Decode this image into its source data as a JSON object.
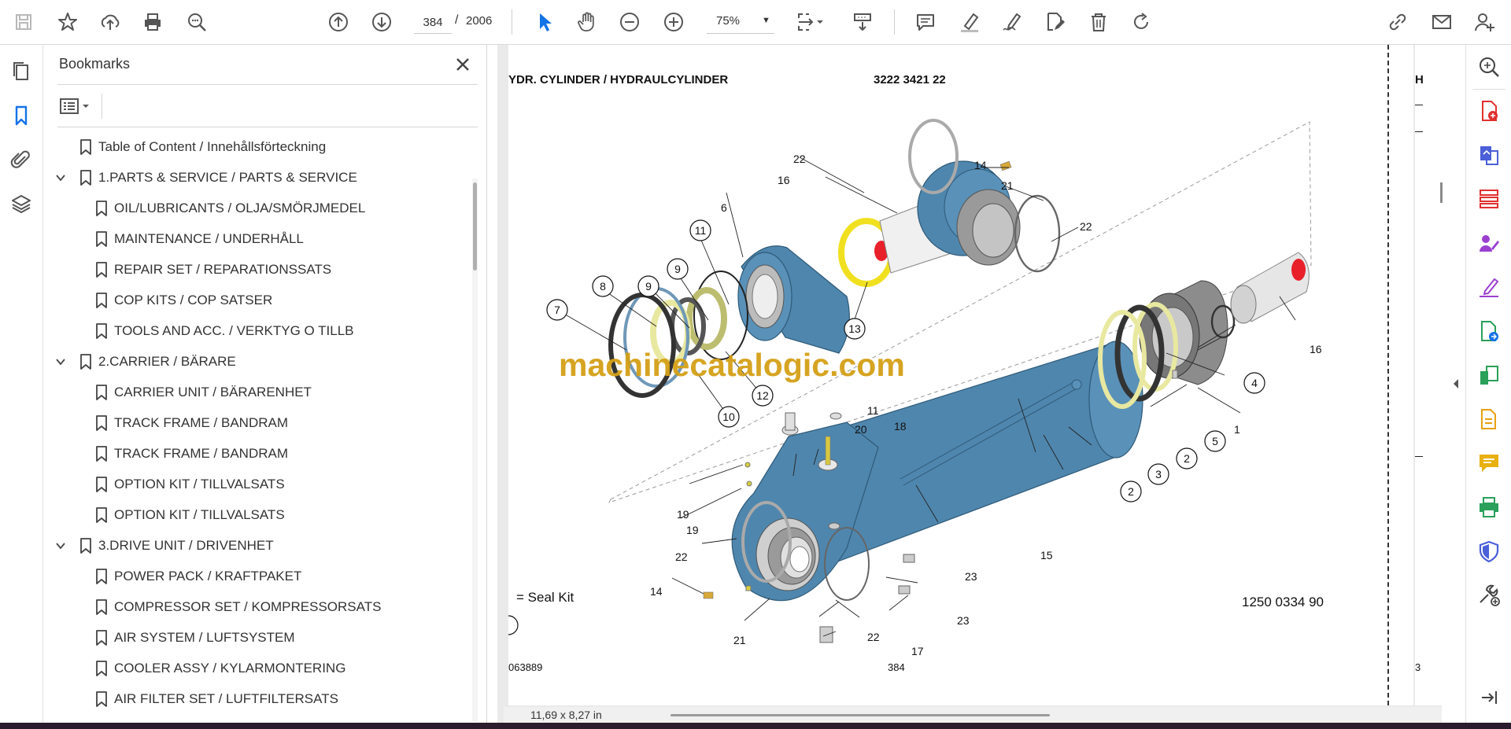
{
  "toolbar": {
    "page_current": "384",
    "page_total": "2006",
    "page_separator": "/",
    "zoom": "75%",
    "icons": [
      "save-icon",
      "star-icon",
      "upload-icon",
      "print-icon",
      "search-icon",
      "page-up-icon",
      "page-down-icon",
      "select-cursor-icon",
      "hand-icon",
      "zoom-out-icon",
      "zoom-in-icon",
      "fit-page-icon",
      "scroll-mode-icon",
      "comment-icon",
      "highlight-icon",
      "draw-icon",
      "edit-icon",
      "delete-icon",
      "rotate-icon",
      "share-link-icon",
      "email-icon",
      "account-icon"
    ]
  },
  "left_rail": {
    "icons": [
      "pages-icon",
      "bookmark-icon",
      "attachment-icon",
      "layers-icon"
    ]
  },
  "bookmarks": {
    "title": "Bookmarks",
    "items": [
      {
        "label": "Table of Content / Innehållsförteckning",
        "level": 0,
        "expandable": false
      },
      {
        "label": "1.PARTS & SERVICE / PARTS & SERVICE",
        "level": 0,
        "expandable": true
      },
      {
        "label": "OIL/LUBRICANTS / OLJA/SMÖRJMEDEL",
        "level": 1,
        "expandable": false
      },
      {
        "label": "MAINTENANCE / UNDERHÅLL",
        "level": 1,
        "expandable": false
      },
      {
        "label": "REPAIR SET / REPARATIONSSATS",
        "level": 1,
        "expandable": false
      },
      {
        "label": "COP KITS / COP SATSER",
        "level": 1,
        "expandable": false
      },
      {
        "label": "TOOLS AND ACC. / VERKTYG O TILLB",
        "level": 1,
        "expandable": false
      },
      {
        "label": "2.CARRIER / BÄRARE",
        "level": 0,
        "expandable": true
      },
      {
        "label": "CARRIER UNIT / BÄRARENHET",
        "level": 1,
        "expandable": false
      },
      {
        "label": "TRACK FRAME / BANDRAM",
        "level": 1,
        "expandable": false
      },
      {
        "label": "TRACK FRAME / BANDRAM",
        "level": 1,
        "expandable": false
      },
      {
        "label": "OPTION KIT / TILLVALSATS",
        "level": 1,
        "expandable": false
      },
      {
        "label": "OPTION KIT / TILLVALSATS",
        "level": 1,
        "expandable": false
      },
      {
        "label": "3.DRIVE UNIT / DRIVENHET",
        "level": 0,
        "expandable": true
      },
      {
        "label": "POWER PACK / KRAFTPAKET",
        "level": 1,
        "expandable": false
      },
      {
        "label": "COMPRESSOR SET / KOMPRESSORSATS",
        "level": 1,
        "expandable": false
      },
      {
        "label": "AIR SYSTEM / LUFTSYSTEM",
        "level": 1,
        "expandable": false
      },
      {
        "label": "COOLER ASSY / KYLARMONTERING",
        "level": 1,
        "expandable": false
      },
      {
        "label": "AIR FILTER SET / LUFTFILTERSATS",
        "level": 1,
        "expandable": false
      }
    ]
  },
  "document": {
    "header_title": "YDR. CYLINDER / HYDRAULCYLINDER",
    "part_number": "3222 3421 22",
    "seal_kit_legend": "= Seal Kit",
    "drawing_number": "1250 0334 90",
    "footer_left": "063889",
    "footer_page": "384",
    "next_page_header": "H",
    "next_page_footer": "3",
    "watermark": "machinecatalogic.com",
    "callouts": [
      "1",
      "2",
      "2",
      "3",
      "4",
      "5",
      "6",
      "7",
      "8",
      "9",
      "9",
      "10",
      "11",
      "12",
      "13",
      "14",
      "14",
      "15",
      "16",
      "16",
      "17",
      "18",
      "19",
      "19",
      "20",
      "21",
      "21",
      "22",
      "22",
      "22",
      "22",
      "23",
      "23",
      "11"
    ],
    "colors": {
      "cylinder_blue": "#4f86ad",
      "seal_yellow": "#e8e8a0",
      "bright_yellow": "#f0e020",
      "red": "#e8202a",
      "grey_metal": "#8c8c8c"
    }
  },
  "status_bar": {
    "page_size": "11,69 x 8,27 in"
  },
  "right_rail": {
    "icons": [
      "zoom-tool-icon",
      "create-pdf-icon",
      "export-pdf-icon",
      "organize-pages-icon",
      "fill-sign-icon",
      "request-signature-icon",
      "combine-files-icon",
      "compress-icon",
      "convert-icon",
      "comment-tool-icon",
      "print-production-icon",
      "protect-icon",
      "more-tools-icon",
      "expand-panel-icon"
    ]
  }
}
